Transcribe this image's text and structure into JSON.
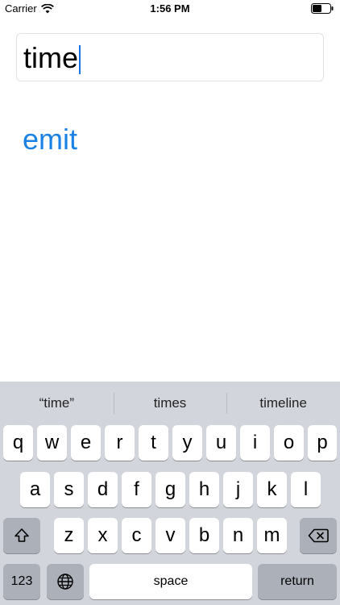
{
  "status_bar": {
    "carrier": "Carrier",
    "time": "1:56 PM"
  },
  "input": {
    "value": "time"
  },
  "emit_label": "emit",
  "keyboard": {
    "suggestions": [
      "“time”",
      "times",
      "timeline"
    ],
    "row1": [
      "q",
      "w",
      "e",
      "r",
      "t",
      "y",
      "u",
      "i",
      "o",
      "p"
    ],
    "row2": [
      "a",
      "s",
      "d",
      "f",
      "g",
      "h",
      "j",
      "k",
      "l"
    ],
    "row3": [
      "z",
      "x",
      "c",
      "v",
      "b",
      "n",
      "m"
    ],
    "numbers_label": "123",
    "space_label": "space",
    "return_label": "return"
  },
  "colors": {
    "link": "#1a82e6",
    "keyboard_bg": "#d2d5db",
    "function_key": "#abb0b9"
  }
}
